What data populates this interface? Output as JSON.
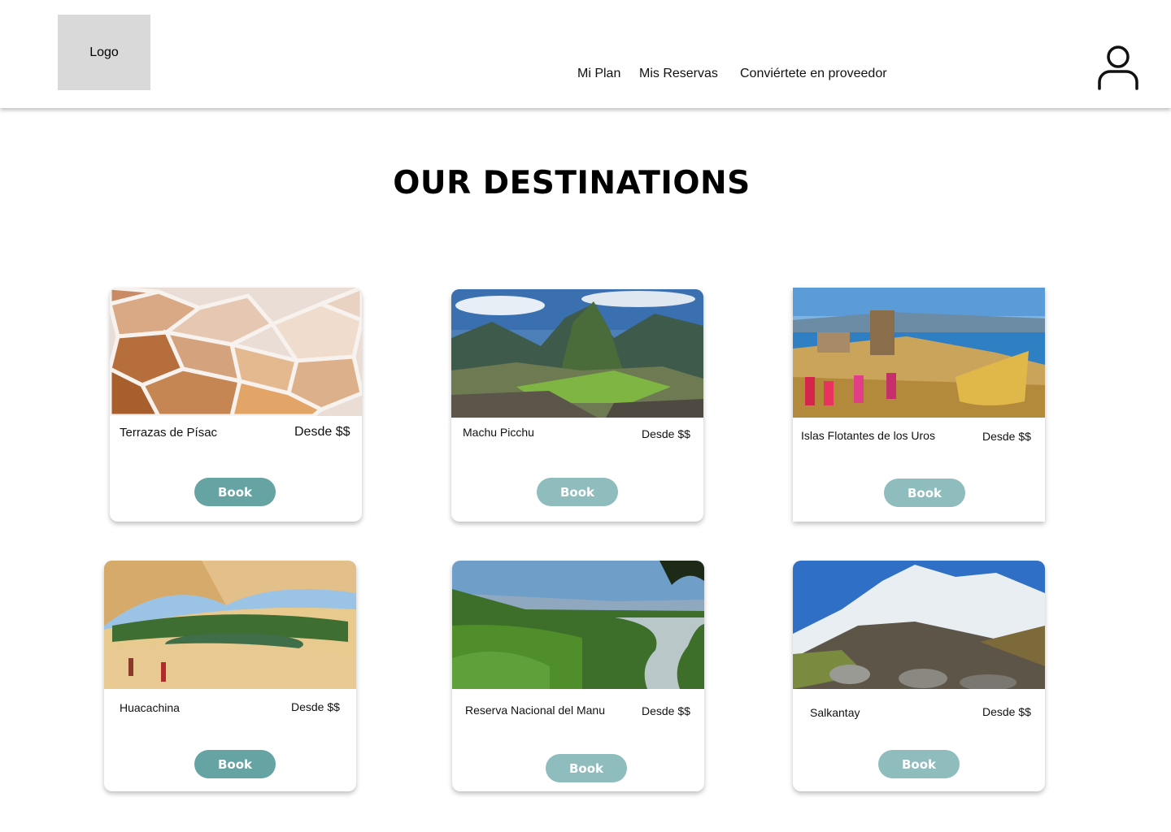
{
  "header": {
    "logo_text": "Logo",
    "nav": [
      {
        "label": "Mi Plan"
      },
      {
        "label": "Mis Reservas"
      },
      {
        "label": "Conviértete en proveedor"
      }
    ]
  },
  "page_title": "OUR DESTINATIONS",
  "destinations": [
    {
      "name": "Terrazas de Písac",
      "price": "Desde $$",
      "button": "Book"
    },
    {
      "name": "Machu Picchu",
      "price": "Desde $$",
      "button": "Book"
    },
    {
      "name": "Islas Flotantes de los Uros",
      "price": "Desde $$",
      "button": "Book"
    },
    {
      "name": "Huacachina",
      "price": "Desde $$",
      "button": "Book"
    },
    {
      "name": "Reserva Nacional del Manu",
      "price": "Desde $$",
      "button": "Book"
    },
    {
      "name": "Salkantay",
      "price": "Desde $$",
      "button": "Book"
    }
  ],
  "colors": {
    "button_dark": "#66a3a3",
    "button_light": "#8fbcbc",
    "logo_placeholder": "#d9d9d9"
  }
}
